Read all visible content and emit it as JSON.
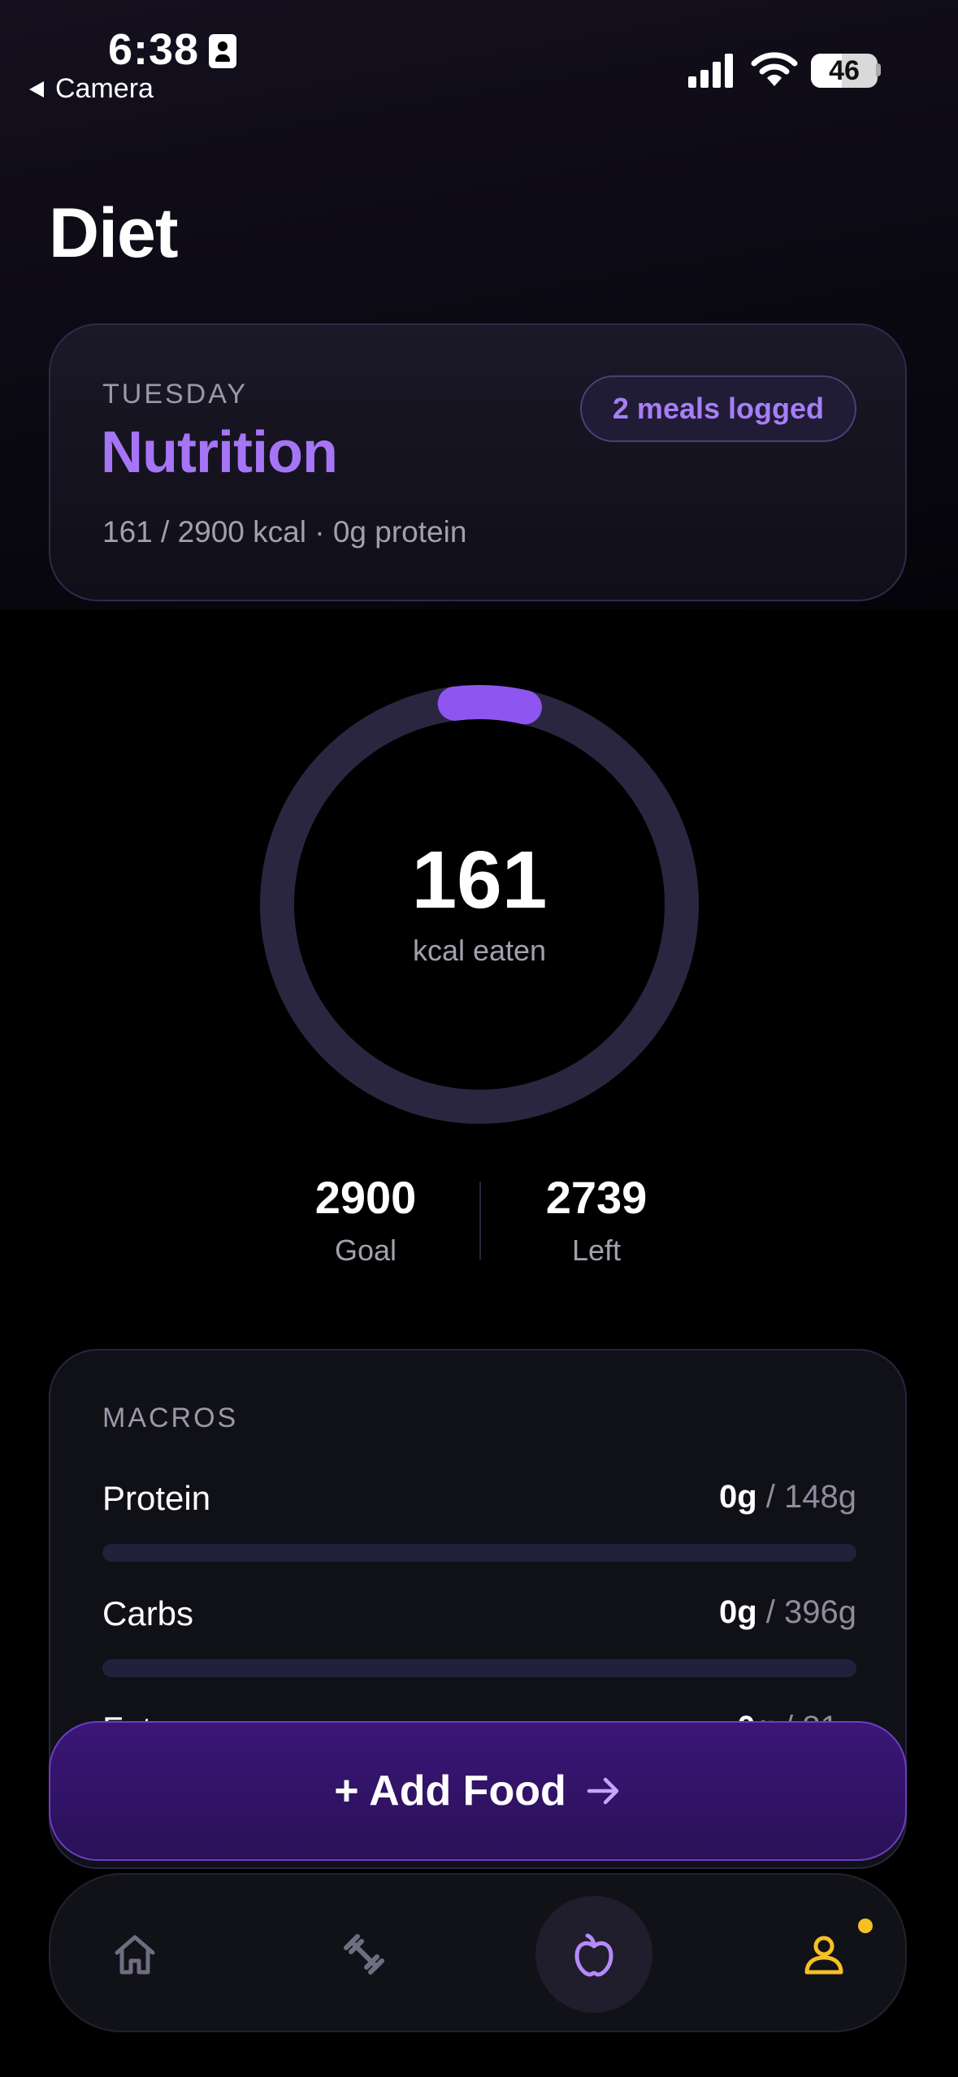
{
  "status_bar": {
    "time": "6:38",
    "back_label": "Camera",
    "battery": "46",
    "battery_level": 0.46
  },
  "page": {
    "title": "Diet"
  },
  "summary": {
    "day": "TUESDAY",
    "title": "Nutrition",
    "subtitle": "161 / 2900 kcal · 0g protein",
    "badge": "2 meals logged"
  },
  "calories": {
    "eaten": "161",
    "eaten_caption": "kcal eaten",
    "goal": "2900",
    "goal_label": "Goal",
    "left": "2739",
    "left_label": "Left",
    "progress": 0.0555
  },
  "macros": {
    "title": "MACROS",
    "items": [
      {
        "name": "Protein",
        "eaten": "0g",
        "separator": "/",
        "goal": "148g",
        "progress": 0
      },
      {
        "name": "Carbs",
        "eaten": "0g",
        "separator": "/",
        "goal": "396g",
        "progress": 0
      },
      {
        "name": "Fat",
        "eaten": "0g",
        "separator": "/",
        "goal": "81g",
        "progress": 0
      }
    ]
  },
  "actions": {
    "add_food": "+ Add Food"
  },
  "tab_bar": {
    "tabs": [
      {
        "icon": "home-icon"
      },
      {
        "icon": "dumbbell-icon"
      },
      {
        "icon": "apple-icon",
        "active": true
      },
      {
        "icon": "profile-icon"
      }
    ]
  },
  "colors": {
    "accent": "#a675f5",
    "ring_progress": "#8e55f0",
    "ring_track": "#2b2640",
    "button": "#2a1158",
    "notification": "#f5c027"
  }
}
